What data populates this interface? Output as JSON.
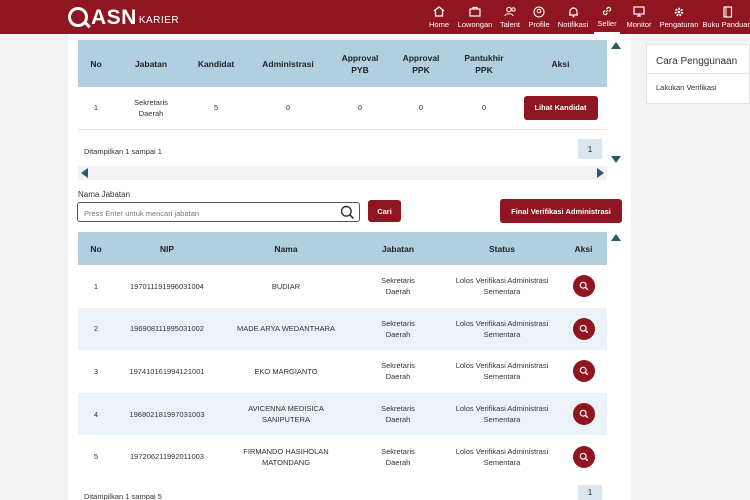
{
  "brand": {
    "asn": "ASN",
    "karier": "KARIER"
  },
  "nav": [
    {
      "label": "Home",
      "icon": "home-icon"
    },
    {
      "label": "Lowongan",
      "icon": "briefcase-icon"
    },
    {
      "label": "Talent",
      "icon": "users-icon"
    },
    {
      "label": "Profile",
      "icon": "profile-icon"
    },
    {
      "label": "Notifikasi",
      "icon": "bell-icon"
    },
    {
      "label": "Seller",
      "icon": "link-icon"
    },
    {
      "label": "Monitor",
      "icon": "monitor-icon"
    },
    {
      "label": "Pengaturan",
      "icon": "gear-icon"
    },
    {
      "label": "Buku Panduan",
      "icon": "book-icon"
    }
  ],
  "summary_table": {
    "headers": [
      "No",
      "Jabatan",
      "Kandidat",
      "Administrasi",
      "Approval PYB",
      "Approval PPK",
      "Pantukhir PPK",
      "Aksi"
    ],
    "row": {
      "no": "1",
      "jabatan": "Sekretaris Daerah",
      "kandidat": "5",
      "administrasi": "0",
      "approval_pyb": "0",
      "approval_ppk": "0",
      "pantukhir_ppk": "0",
      "action": "Lihat Kandidat"
    },
    "info": "Ditampilkan 1 sampai 1",
    "page": "1"
  },
  "search": {
    "label": "Nama Jabatan",
    "placeholder": "Press Enter untuk mencari jabatan",
    "button": "Cari",
    "final_button": "Final Verifikasi Administrasi"
  },
  "candidate_table": {
    "headers": [
      "No",
      "NIP",
      "Nama",
      "Jabatan",
      "Status",
      "Aksi"
    ],
    "rows": [
      {
        "no": "1",
        "nip": "197011191996031004",
        "nama": "BUDIAR",
        "jabatan": "Sekretaris Daerah",
        "status": "Lolos Verifikasi Administrasi Sementara"
      },
      {
        "no": "2",
        "nip": "196908111995031002",
        "nama": "MADE ARYA WEDANTHARA",
        "jabatan": "Sekretaris Daerah",
        "status": "Lolos Verifikasi Administrasi Sementara"
      },
      {
        "no": "3",
        "nip": "197410161994121001",
        "nama": "EKO MARGIANTO",
        "jabatan": "Sekretaris Daerah",
        "status": "Lolos Verifikasi Administrasi Sementara"
      },
      {
        "no": "4",
        "nip": "196802181997031003",
        "nama": "AVICENNA MEDISICA SANIPUTERA",
        "jabatan": "Sekretaris Daerah",
        "status": "Lolos Verifikasi Administrasi Sementara"
      },
      {
        "no": "5",
        "nip": "197206211992011003",
        "nama": "FIRMANDO HASIHOLAN MATONDANG",
        "jabatan": "Sekretaris Daerah",
        "status": "Lolos Verifikasi Administrasi Sementara"
      }
    ],
    "info": "Ditampilkan 1 sampai 5",
    "page": "1"
  },
  "side_panel": {
    "title": "Cara Penggunaan",
    "link": "Lakukan Verifikasi"
  },
  "colors": {
    "brand": "#8f1520",
    "table_header": "#b0cfe0",
    "row_alt": "#ebf3f8"
  }
}
